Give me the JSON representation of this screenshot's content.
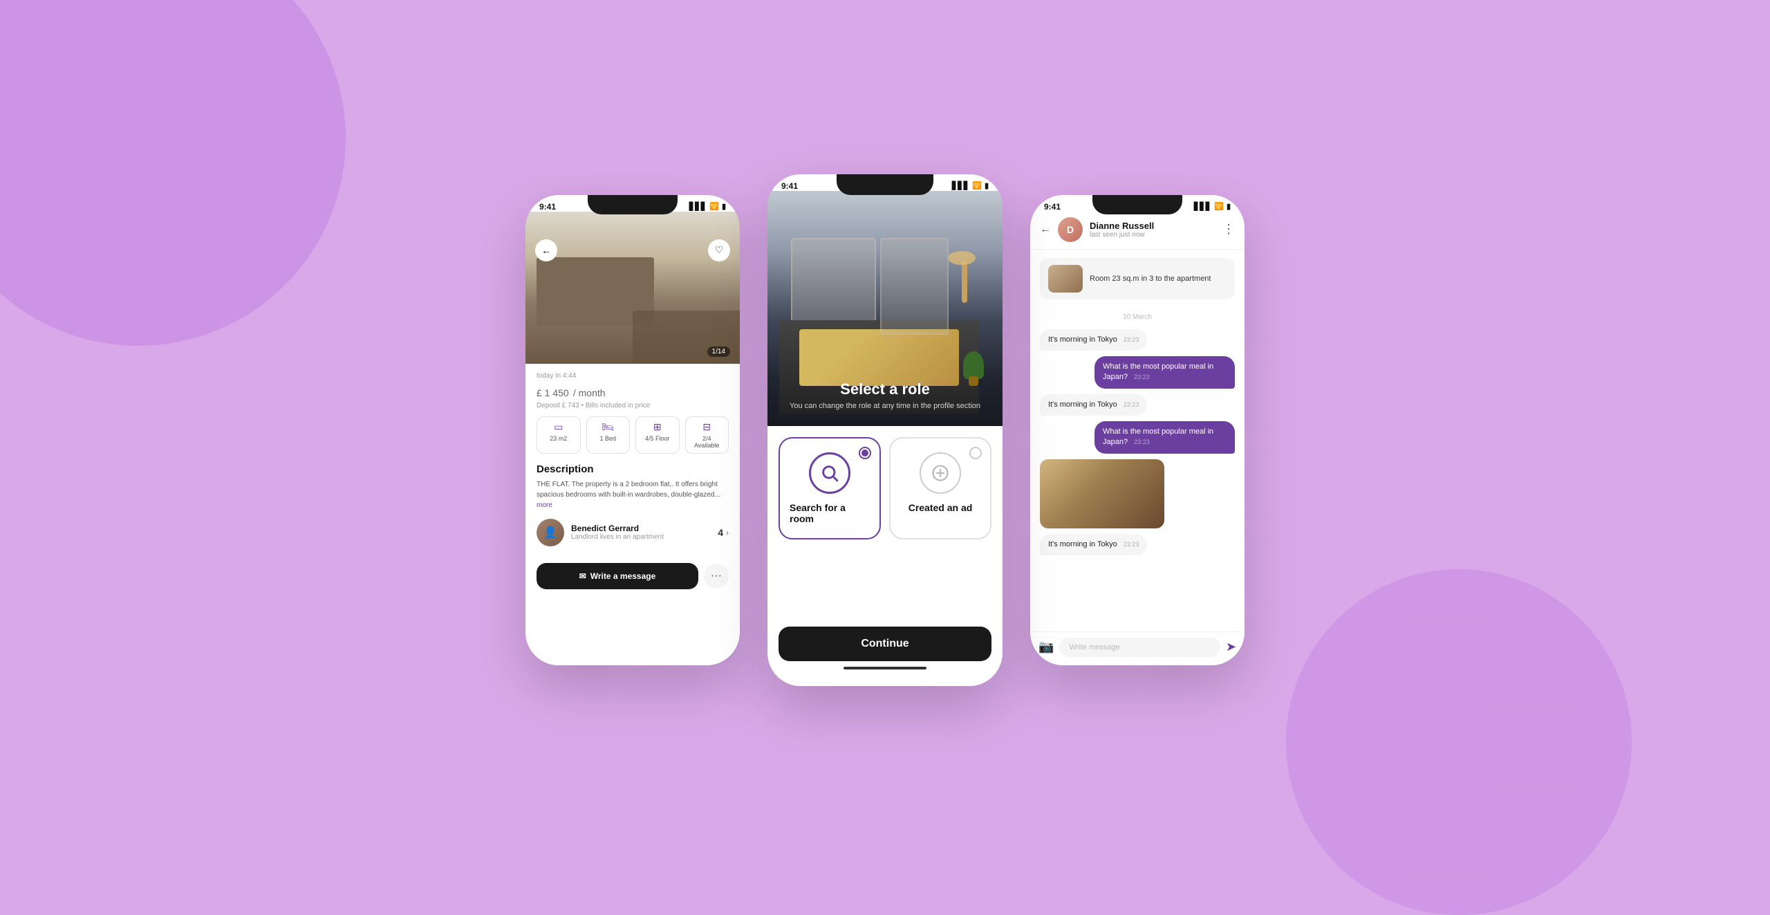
{
  "background": "#d9a8e8",
  "phone1": {
    "status_time": "9:41",
    "image_counter": "1/14",
    "date": "today in 4:44",
    "price": "£ 1 450",
    "price_period": "/ month",
    "deposit": "Deposit £ 743  •  Bills included in price",
    "features": [
      {
        "icon": "▭",
        "label": "23 m2"
      },
      {
        "icon": "⊡",
        "label": "1 Bed"
      },
      {
        "icon": "⊞",
        "label": "4/5 Floor"
      },
      {
        "icon": "⊟",
        "label": "2/4 Available"
      }
    ],
    "description_title": "Description",
    "description_text": "THE FLAT. The property is a 2 bedroom flat,. It offers bright spacious bedrooms with built-in wardrobes, double-glazed...",
    "more_label": "more",
    "landlord_name": "Benedict Gerrard",
    "landlord_subtitle": "Landlord lives in an apartment",
    "landlord_count": "4",
    "message_btn": "Write a message"
  },
  "phone2": {
    "status_time": "9:41",
    "hero_title": "Select a role",
    "hero_subtitle": "You can change the role at any time\nin the profile section",
    "role_search_label": "Search for a room",
    "role_ad_label": "Created an ad",
    "continue_btn": "Continue"
  },
  "phone3": {
    "status_time": "9:41",
    "user_name": "Dianne Russell",
    "user_status": "last seen just now",
    "property_card_text": "Room 23 sq.m in 3 to the apartment",
    "messages": [
      {
        "side": "left",
        "text": "It's morning in Tokyo",
        "time": "23:23"
      },
      {
        "side": "right",
        "text": "What is the most popular meal in Japan?",
        "time": "23:23"
      },
      {
        "side": "left",
        "text": "It's morning in Tokyo",
        "time": "23:23"
      },
      {
        "side": "right",
        "text": "What is the most popular meal in Japan?",
        "time": "23:23"
      },
      {
        "side": "left",
        "text": "It's morning in Tokyo",
        "time": "23:23"
      }
    ],
    "input_placeholder": "Write message"
  }
}
